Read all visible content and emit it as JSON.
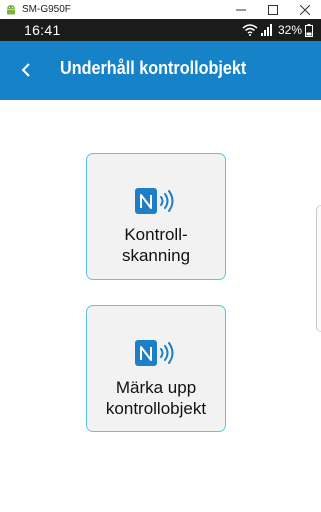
{
  "window": {
    "device_title": "SM-G950F"
  },
  "status_bar": {
    "time": "16:41",
    "battery_percent": "32%"
  },
  "app_bar": {
    "title": "Underhåll kontrollobjekt"
  },
  "actions": [
    {
      "icon": "nfc-icon",
      "label": "Kontroll-\nskanning"
    },
    {
      "icon": "nfc-icon",
      "label": "Märka upp\nkontrollobjekt"
    }
  ],
  "colors": {
    "app_bar": "#1683c8",
    "card_border": "#5ec4e6",
    "card_bg": "#f2f2f2",
    "status_bar": "#1b1b1b"
  }
}
